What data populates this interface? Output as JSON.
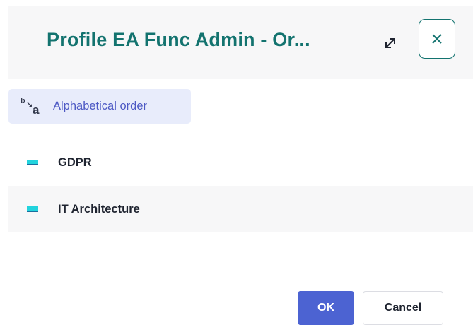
{
  "dialog": {
    "title": "Profile EA Func Admin - Or...",
    "expand_icon": "expand-arrows-icon",
    "close_icon": "close-icon"
  },
  "sort": {
    "icon": "sort-alphabetical-icon",
    "icon_b": "b",
    "icon_arrow": "↘",
    "icon_a": "a",
    "label": "Alphabetical order"
  },
  "items": [
    {
      "label": "GDPR",
      "icon": "object-type-icon"
    },
    {
      "label": "IT Architecture",
      "icon": "object-type-icon"
    }
  ],
  "footer": {
    "ok_label": "OK",
    "cancel_label": "Cancel"
  },
  "colors": {
    "title": "#13736f",
    "primary": "#4c63d2",
    "sort_bg": "#e8ecfb",
    "item_icon": "#22d3dd"
  }
}
